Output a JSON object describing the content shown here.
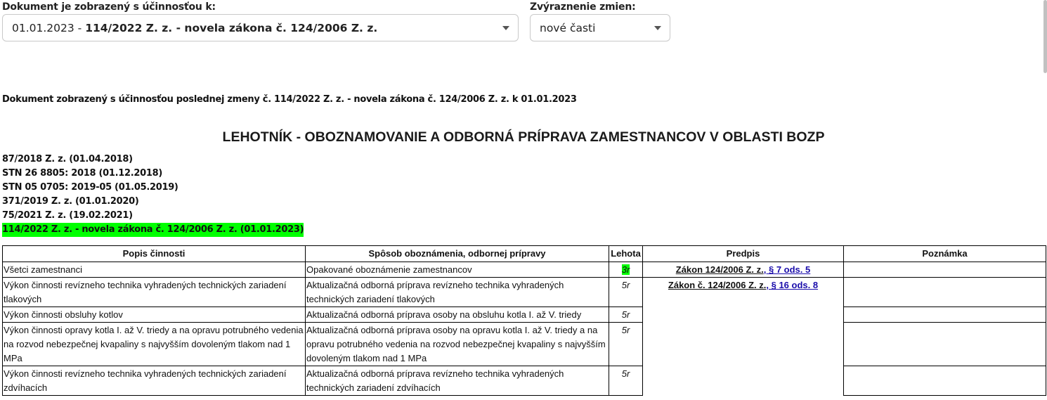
{
  "filters": {
    "effectivity_label": "Dokument je zobrazený s účinnosťou k:",
    "effectivity_date": "01.01.2023 - ",
    "effectivity_bold": "114/2022 Z. z. - novela zákona č. 124/2006 Z. z.",
    "highlight_label": "Zvýraznenie zmien:",
    "highlight_value": "nové časti"
  },
  "info_line": "Dokument zobrazený s účinnosťou poslednej zmeny č. 114/2022 Z. z. - novela zákona č. 124/2006 Z. z. k 01.01.2023",
  "title": "LEHOTNÍK - OBOZNAMOVANIE A ODBORNÁ PRÍPRAVA ZAMESTNANCOV V OBLASTI BOZP",
  "references": [
    "87/2018 Z. z. (01.04.2018)",
    "STN 26 8805: 2018 (01.12.2018)",
    "STN 05 0705: 2019-05 (01.05.2019)",
    "371/2019 Z. z. (01.01.2020)",
    "75/2021 Z. z. (19.02.2021)",
    "114/2022 Z. z. - novela zákona č. 124/2006 Z. z. (01.01.2023)"
  ],
  "table": {
    "headers": [
      "Popis činnosti",
      "Spôsob oboznámenia, odbornej prípravy",
      "Lehota",
      "Predpis",
      "Poznámka"
    ],
    "rows": [
      {
        "popis": "Všetci zamestnanci",
        "sposob": "Opakované oboznámenie zamestnancov",
        "lehota": "3r",
        "predpis_text": "Zákon 124/2006 Z. z.",
        "predpis_link": ", § 7 ods. 5",
        "poznamka": ""
      },
      {
        "popis": "Výkon činnosti revízneho technika vyhradených technických zariadení tlakových",
        "sposob": "Aktualizačná odborná príprava revízneho technika vyhradených technických zariadení tlakových",
        "lehota": "5r",
        "predpis_text": "Zákon č. 124/2006 Z. z.",
        "predpis_link": ", § 16 ods. 8",
        "poznamka": ""
      },
      {
        "popis": "Výkon činnosti obsluhy kotlov",
        "sposob": "Aktualizačná odborná príprava osoby na obsluhu kotla I. až V. triedy",
        "lehota": "5r",
        "poznamka": ""
      },
      {
        "popis": "Výkon činnosti opravy kotla I. až V. triedy a na opravu potrubného vedenia na rozvod nebezpečnej kvapaliny s najvyšším dovoleným tlakom nad 1 MPa",
        "sposob": "Aktualizačná odborná príprava osoby na opravu kotla I. až V. triedy a na opravu potrubného vedenia na rozvod nebezpečnej kvapaliny s najvyšším dovoleným tlakom nad 1 MPa",
        "lehota": "5r",
        "poznamka": ""
      },
      {
        "popis": "Výkon činnosti revízneho technika vyhradených technických zariadení zdvíhacích",
        "sposob": "Aktualizačná odborná príprava revízneho technika vyhradených technických zariadení zdvíhacích",
        "lehota": "5r",
        "poznamka": ""
      }
    ]
  },
  "colors": {
    "highlight": "#00ff00",
    "link": "#1a0dab"
  }
}
